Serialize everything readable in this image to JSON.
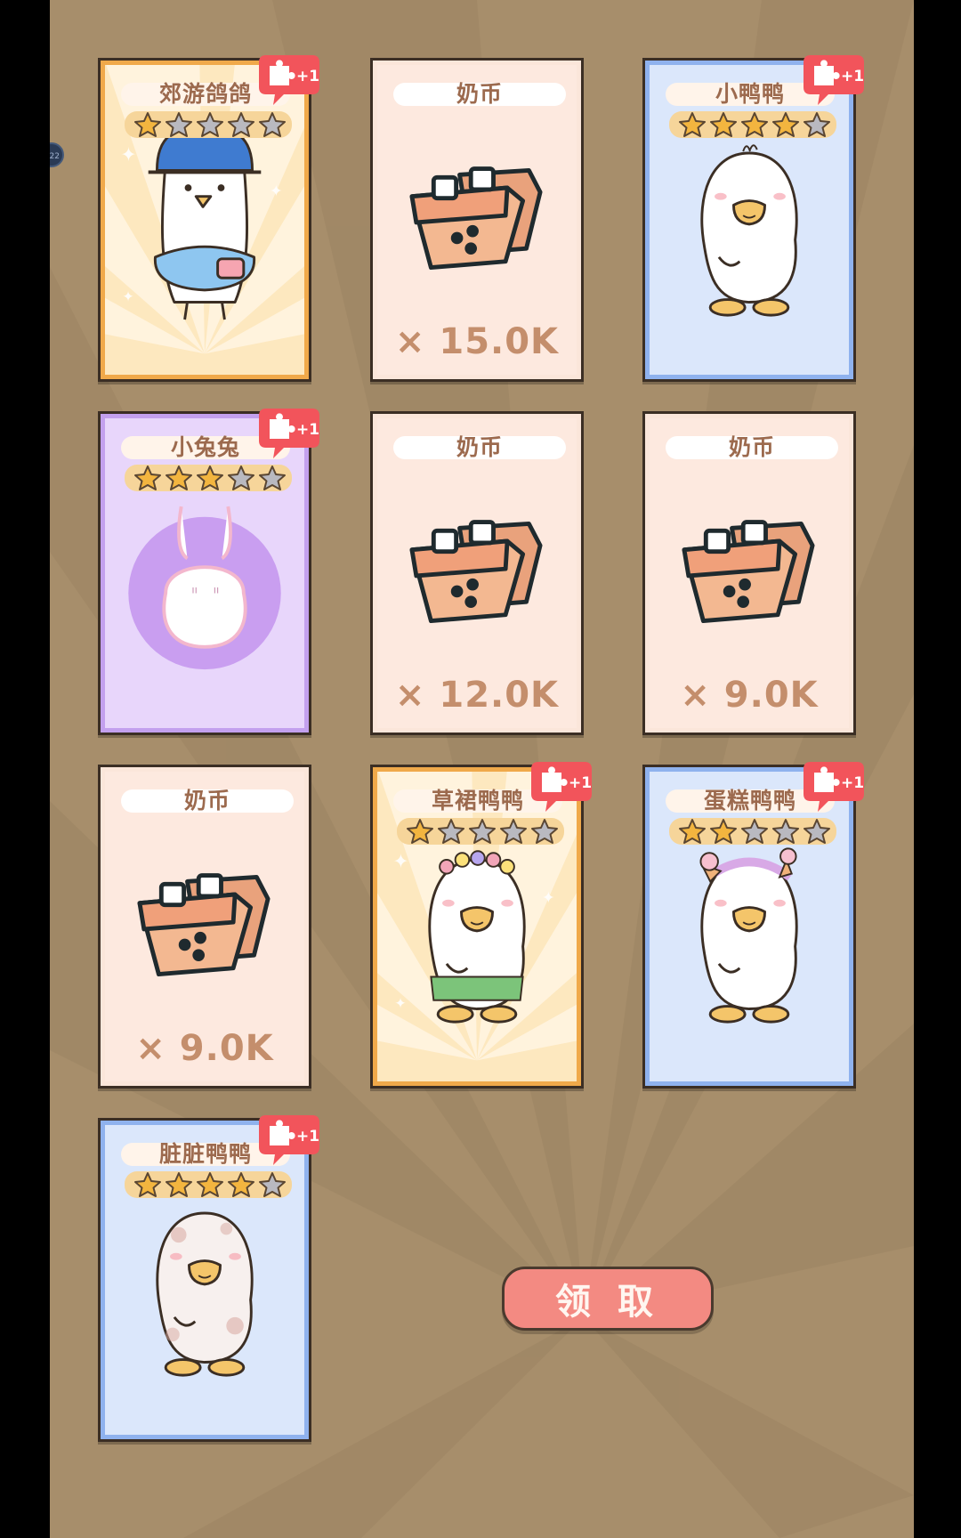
{
  "side_badge": "22",
  "cards": [
    {
      "kind": "char",
      "frame": "orange",
      "name": "郊游鸽鸽",
      "stars": 1,
      "badge": "+1",
      "art": "pigeon"
    },
    {
      "kind": "coin",
      "name": "奶币",
      "amount": "× 15.0K"
    },
    {
      "kind": "char",
      "frame": "blue",
      "name": "小鸭鸭",
      "stars": 4,
      "badge": "+1",
      "art": "duck"
    },
    {
      "kind": "char",
      "frame": "purple",
      "name": "小兔兔",
      "stars": 3,
      "badge": "+1",
      "art": "bunny"
    },
    {
      "kind": "coin",
      "name": "奶币",
      "amount": "× 12.0K"
    },
    {
      "kind": "coin",
      "name": "奶币",
      "amount": "× 9.0K"
    },
    {
      "kind": "coin",
      "name": "奶币",
      "amount": "× 9.0K"
    },
    {
      "kind": "char",
      "frame": "orange",
      "name": "草裙鸭鸭",
      "stars": 1,
      "badge": "+1",
      "art": "hula"
    },
    {
      "kind": "char",
      "frame": "blue",
      "name": "蛋糕鸭鸭",
      "stars": 2,
      "badge": "+1",
      "art": "cake"
    },
    {
      "kind": "char",
      "frame": "blue",
      "name": "脏脏鸭鸭",
      "stars": 4,
      "badge": "+1",
      "art": "dirty"
    }
  ],
  "claim_button": "领 取",
  "colors": {
    "background": "#a78e6b",
    "coin_text": "#c48e6c",
    "badge_red": "#f2545b",
    "button": "#f38a82"
  }
}
